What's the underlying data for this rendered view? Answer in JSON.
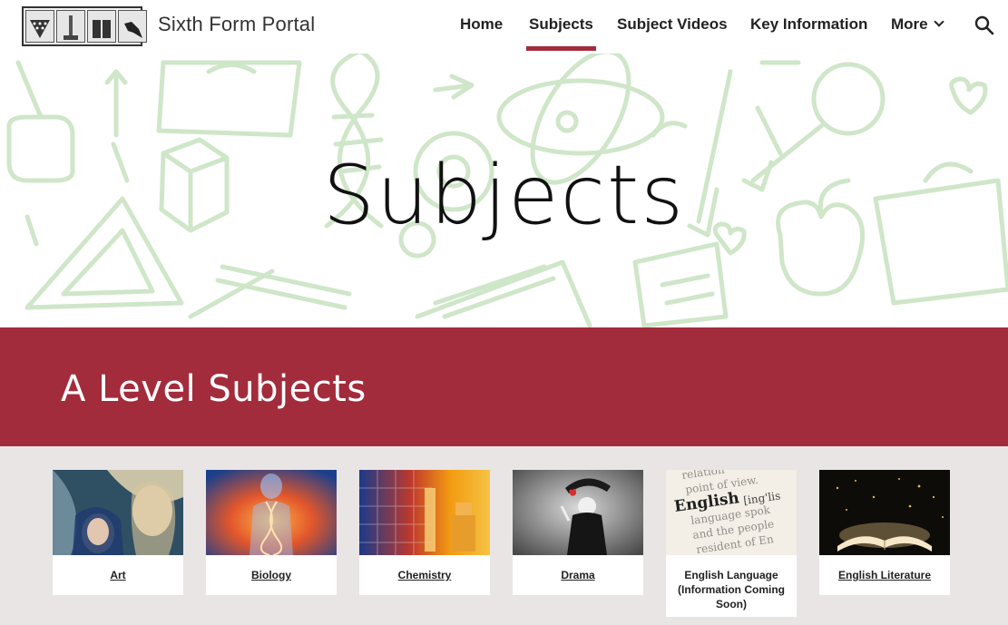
{
  "header": {
    "site_title": "Sixth Form Portal",
    "nav": [
      {
        "label": "Home",
        "active": false
      },
      {
        "label": "Subjects",
        "active": true
      },
      {
        "label": "Subject Videos",
        "active": false
      },
      {
        "label": "Key Information",
        "active": false
      },
      {
        "label": "More",
        "active": false
      }
    ],
    "search_icon": "search-icon",
    "more_icon": "chevron-down-icon"
  },
  "hero": {
    "title": "Subjects"
  },
  "band": {
    "title": "A Level Subjects"
  },
  "subjects": [
    {
      "label": "Art",
      "link": true
    },
    {
      "label": "Biology",
      "link": true
    },
    {
      "label": "Chemistry",
      "link": true
    },
    {
      "label": "Drama",
      "link": true
    },
    {
      "label": "English Language (Information Coming Soon)",
      "link": false
    },
    {
      "label": "English Literature",
      "link": true
    }
  ],
  "colors": {
    "accent": "#a32c3c",
    "doodle": "#cfe6c9",
    "card_bg": "#e9e5e5"
  }
}
